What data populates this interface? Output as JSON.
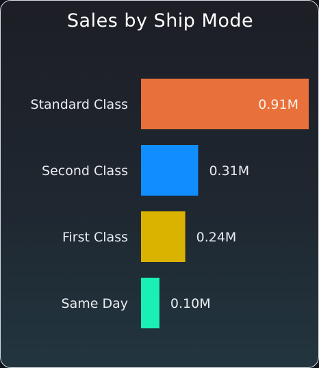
{
  "chart_data": {
    "type": "bar",
    "orientation": "horizontal",
    "title": "Sales by Ship Mode",
    "categories": [
      "Standard Class",
      "Second Class",
      "First Class",
      "Same Day"
    ],
    "values": [
      0.91,
      0.31,
      0.24,
      0.1
    ],
    "data_labels": [
      "0.91M",
      "0.31M",
      "0.24M",
      "0.10M"
    ],
    "unit": "M",
    "colors": [
      "#e8703a",
      "#118dff",
      "#d9b300",
      "#1aefb5"
    ],
    "xlabel": "",
    "ylabel": "",
    "grid": false,
    "legend": "none"
  }
}
